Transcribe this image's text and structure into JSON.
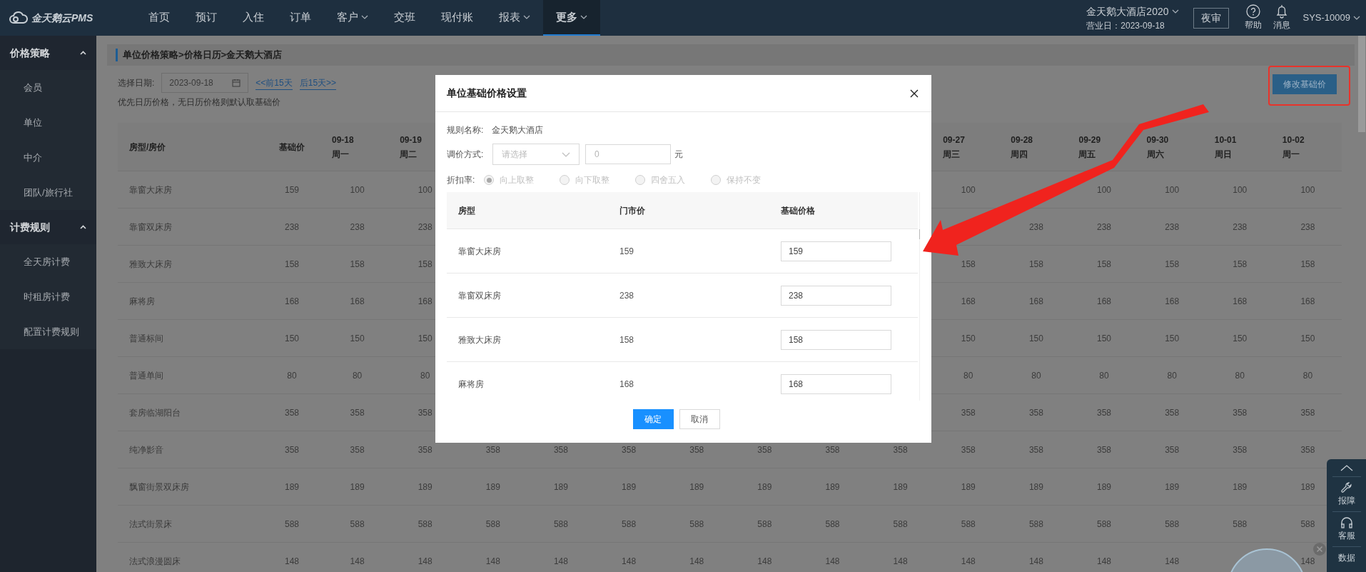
{
  "nav": {
    "logo": "金天鹅云PMS",
    "items": [
      {
        "label": "首页",
        "dropdown": false,
        "selected": false
      },
      {
        "label": "预订",
        "dropdown": false,
        "selected": false
      },
      {
        "label": "入住",
        "dropdown": false,
        "selected": false
      },
      {
        "label": "订单",
        "dropdown": false,
        "selected": false
      },
      {
        "label": "客户",
        "dropdown": true,
        "selected": false
      },
      {
        "label": "交班",
        "dropdown": false,
        "selected": false
      },
      {
        "label": "现付账",
        "dropdown": false,
        "selected": false
      },
      {
        "label": "报表",
        "dropdown": true,
        "selected": false
      },
      {
        "label": "更多",
        "dropdown": true,
        "selected": true
      }
    ],
    "hotel": "金天鹅大酒店2020",
    "business_date": "营业日：2023-09-18",
    "night_audit": "夜审",
    "help": "帮助",
    "messages": "消息",
    "user": "SYS-10009"
  },
  "sidebar": [
    {
      "label": "价格策略",
      "expanded": true,
      "children": [
        {
          "label": "会员"
        },
        {
          "label": "单位"
        },
        {
          "label": "中介"
        },
        {
          "label": "团队/旅行社"
        }
      ]
    },
    {
      "label": "计费规则",
      "expanded": true,
      "children": [
        {
          "label": "全天房计费"
        },
        {
          "label": "时租房计费"
        },
        {
          "label": "配置计费规则"
        }
      ]
    }
  ],
  "breadcrumb": "单位价格策略>价格日历>金天鹅大酒店",
  "date_filter": {
    "label": "选择日期:",
    "value": "2023-09-18",
    "prev": "<<前15天",
    "next": "后15天>>"
  },
  "hint": "优先日历价格，无日历价格则默认取基础价",
  "edit_button": "修改基础价",
  "table": {
    "name_header": "房型/房价",
    "base_header": "基础价",
    "dates_left": [
      {
        "date": "09-18",
        "weekday": "周一"
      },
      {
        "date": "09-19",
        "weekday": "周二"
      }
    ],
    "dates_right": [
      {
        "date": "09-27",
        "weekday": "周三"
      },
      {
        "date": "09-28",
        "weekday": "周四"
      },
      {
        "date": "09-29",
        "weekday": "周五"
      },
      {
        "date": "09-30",
        "weekday": "周六"
      },
      {
        "date": "10-01",
        "weekday": "周日"
      },
      {
        "date": "10-02",
        "weekday": "周一"
      }
    ],
    "rows": [
      {
        "room": "靠窗大床房",
        "base": "159",
        "prices_left": [
          {
            "value": "100"
          },
          {
            "value": "100"
          }
        ],
        "prices_right": [
          {
            "value": "100"
          },
          {
            "hidden": true
          },
          {
            "value": "100"
          },
          {
            "value": "100"
          },
          {
            "value": "100"
          },
          {
            "value": "100"
          }
        ]
      },
      {
        "room": "靠窗双床房",
        "base": "238",
        "prices_left": [
          {
            "value": "238"
          },
          {
            "value": "238"
          }
        ],
        "prices_right": [
          {
            "hidden": true
          },
          {
            "value": "238"
          },
          {
            "value": "238"
          },
          {
            "value": "238"
          },
          {
            "value": "238"
          },
          {
            "value": "238"
          }
        ]
      },
      {
        "room": "雅致大床房",
        "base": "158",
        "prices_left": [
          {
            "value": "158"
          },
          {
            "value": "158"
          }
        ],
        "prices_right": [
          {
            "value": "158"
          },
          {
            "value": "158"
          },
          {
            "value": "158"
          },
          {
            "value": "158"
          },
          {
            "value": "158"
          },
          {
            "value": "158"
          }
        ]
      },
      {
        "room": "麻将房",
        "base": "168",
        "prices_left": [
          {
            "value": "168"
          },
          {
            "value": "168"
          }
        ],
        "prices_right": [
          {
            "value": "168"
          },
          {
            "value": "168"
          },
          {
            "value": "168"
          },
          {
            "value": "168"
          },
          {
            "value": "168"
          },
          {
            "value": "168"
          }
        ]
      },
      {
        "room": "普通标间",
        "base": "150",
        "prices_left": [
          {
            "value": "150"
          },
          {
            "value": "150"
          }
        ],
        "prices_right": [
          {
            "value": "150"
          },
          {
            "value": "150"
          },
          {
            "value": "150"
          },
          {
            "value": "150"
          },
          {
            "value": "150"
          },
          {
            "value": "150"
          }
        ]
      },
      {
        "room": "普通单间",
        "base": "80",
        "prices_left": [
          {
            "value": "80"
          },
          {
            "value": "80"
          }
        ],
        "prices_right": [
          {
            "value": "80"
          },
          {
            "value": "80"
          },
          {
            "value": "80"
          },
          {
            "value": "80"
          },
          {
            "value": "80"
          },
          {
            "value": "80"
          }
        ]
      },
      {
        "room": "套房临湖阳台",
        "base": "358",
        "prices_left": [
          {
            "value": "358"
          },
          {
            "value": "358"
          }
        ],
        "prices_right": [
          {
            "value": "358"
          },
          {
            "value": "358"
          },
          {
            "value": "358"
          },
          {
            "value": "358"
          },
          {
            "value": "358"
          },
          {
            "value": "358"
          }
        ]
      },
      {
        "room": "纯净影音",
        "base": "358",
        "prices": [
          {
            "value": "358"
          },
          {
            "value": "358"
          },
          {
            "value": "358"
          },
          {
            "value": "358"
          },
          {
            "value": "358"
          },
          {
            "value": "358"
          },
          {
            "value": "358"
          },
          {
            "value": "358"
          },
          {
            "value": "358"
          },
          {
            "value": "358"
          },
          {
            "value": "358"
          },
          {
            "value": "358"
          },
          {
            "value": "358"
          },
          {
            "value": "358"
          },
          {
            "value": "358"
          }
        ]
      },
      {
        "room": "飘窗街景双床房",
        "base": "189",
        "prices": [
          {
            "value": "189"
          },
          {
            "value": "189"
          },
          {
            "value": "189"
          },
          {
            "value": "189"
          },
          {
            "value": "189"
          },
          {
            "value": "189"
          },
          {
            "value": "189"
          },
          {
            "value": "189"
          },
          {
            "value": "189"
          },
          {
            "value": "189"
          },
          {
            "value": "189"
          },
          {
            "value": "189"
          },
          {
            "value": "189"
          },
          {
            "value": "189"
          },
          {
            "value": "189"
          }
        ]
      },
      {
        "room": "法式街景床",
        "base": "588",
        "prices": [
          {
            "value": "588"
          },
          {
            "value": "588"
          },
          {
            "value": "588"
          },
          {
            "value": "588"
          },
          {
            "value": "588"
          },
          {
            "value": "588"
          },
          {
            "value": "588"
          },
          {
            "value": "588"
          },
          {
            "value": "588"
          },
          {
            "value": "588"
          },
          {
            "value": "588"
          },
          {
            "value": "588"
          },
          {
            "value": "588"
          },
          {
            "value": "588"
          },
          {
            "value": "588"
          }
        ]
      },
      {
        "room": "法式浪漫圆床",
        "base": "148",
        "prices": [
          {
            "value": "148"
          },
          {
            "value": "148"
          },
          {
            "value": "148"
          },
          {
            "value": "148"
          },
          {
            "value": "148"
          },
          {
            "value": "148"
          },
          {
            "value": "148"
          },
          {
            "value": "148"
          },
          {
            "value": "148"
          },
          {
            "value": "148"
          },
          {
            "value": "148"
          },
          {
            "value": "148"
          },
          {
            "value": "148"
          },
          {
            "hidden": true
          },
          {
            "value": "148"
          }
        ]
      }
    ]
  },
  "side_widget": [
    {
      "kind": "up"
    },
    {
      "kind": "wrench",
      "label": "报障"
    },
    {
      "kind": "headset",
      "label": "客服"
    },
    {
      "kind": "plain",
      "label": "数据"
    }
  ],
  "modal": {
    "title": "单位基础价格设置",
    "rule_label": "规则名称:",
    "rule_name": "金天鹅大酒店",
    "method_label": "调价方式:",
    "method_placeholder": "请选择",
    "amount_placeholder": "0",
    "unit": "元",
    "rounding_label": "折扣率:",
    "rounding": [
      {
        "label": "向上取整",
        "selected": true,
        "disabled": true
      },
      {
        "label": "向下取整",
        "selected": false,
        "disabled": true
      },
      {
        "label": "四舍五入",
        "selected": false,
        "disabled": true
      },
      {
        "label": "保持不变",
        "selected": false,
        "disabled": true
      }
    ],
    "columns": [
      "房型",
      "门市价",
      "基础价格"
    ],
    "rows": [
      {
        "room": "靠窗大床房",
        "rack_rate": "159",
        "base_price": "159"
      },
      {
        "room": "靠窗双床房",
        "rack_rate": "238",
        "base_price": "238"
      },
      {
        "room": "雅致大床房",
        "rack_rate": "158",
        "base_price": "158"
      },
      {
        "room": "麻将房",
        "rack_rate": "168",
        "base_price": "168"
      }
    ],
    "ok": "确定",
    "cancel": "取消"
  }
}
